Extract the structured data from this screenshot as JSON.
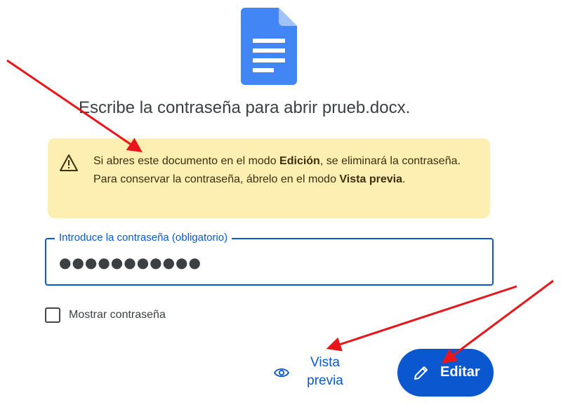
{
  "header": {
    "title": "Escribe la contraseña para abrir prueb.docx.",
    "icon": "google-docs-icon"
  },
  "warning": {
    "icon": "warning-triangle-icon",
    "text_1": "Si abres este documento en el modo ",
    "bold_1": "Edición",
    "text_2": ", se eliminará la contraseña. Para conservar la contraseña, ábrelo en el modo ",
    "bold_2": "Vista previa",
    "text_3": ".",
    "background": "#fdefb2"
  },
  "password": {
    "label": "Introduce la contraseña (obligatorio)",
    "value": "●●●●●●●●●●●",
    "accent": "#0b57d0"
  },
  "show_password": {
    "label": "Mostrar contraseña",
    "checked": false
  },
  "actions": {
    "preview_label": "Vista previa",
    "preview_icon": "eye-icon",
    "edit_label": "Editar",
    "edit_icon": "pencil-icon",
    "primary_color": "#0b57d0"
  },
  "annotations": {
    "arrow_color": "#e8151b"
  }
}
